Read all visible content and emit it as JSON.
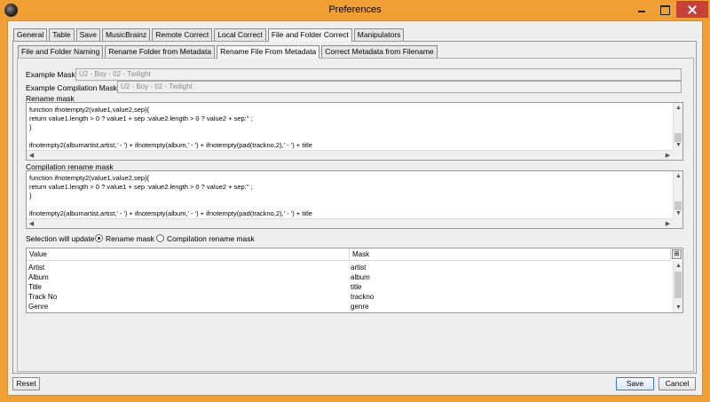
{
  "window": {
    "title": "Preferences"
  },
  "tabs_outer": [
    "General",
    "Table",
    "Save",
    "MusicBrainz",
    "Remote Correct",
    "Local Correct",
    "File and Folder Correct",
    "Manipulators"
  ],
  "tabs_outer_active": "File and Folder Correct",
  "tabs_inner": [
    "File and Folder Naming",
    "Rename Folder from Metadata",
    "Rename File From Metadata",
    "Correct Metadata from Filename"
  ],
  "tabs_inner_active": "Rename File From Metadata",
  "example_mask": {
    "label": "Example Mask:",
    "value": "U2 - Boy - 02 - Twilight"
  },
  "example_compilation_mask": {
    "label": "Example Compilation Mask:",
    "value": "U2 - Boy - 02 - Twilight"
  },
  "rename_mask": {
    "label": "Rename mask",
    "lines": [
      "function ifnotempty2(value1,value2,sep){",
      "    return value1.length > 0 ? value1 + sep :value2.length > 0 ? value2 + sep:'' ;",
      "}",
      "",
      "ifnotempty2(albumartist,artist,' - ') + ifnotempty(album,' - ') + ifnotempty(pad(trackno,2),' - ') + title"
    ]
  },
  "compilation_rename_mask": {
    "label": "Compilation rename mask",
    "lines": [
      "function ifnotempty2(value1,value2,sep){",
      "    return value1.length > 0 ? value1 + sep :value2.length > 0 ? value2 + sep:'' ;",
      "}",
      "",
      "ifnotempty2(albumartist,artist,' - ') + ifnotempty(album,' - ') + ifnotempty(pad(trackno,2),' - ') + title"
    ]
  },
  "selection": {
    "label": "Selection will update",
    "options": [
      "Rename mask",
      "Compilation rename mask"
    ],
    "selected": "Rename mask"
  },
  "table": {
    "headers": [
      "Value",
      "Mask"
    ],
    "rows": [
      [
        "Artist",
        "artist"
      ],
      [
        "Album",
        "album"
      ],
      [
        "Title",
        "title"
      ],
      [
        "Track No",
        "trackno"
      ],
      [
        "Genre",
        "genre"
      ]
    ]
  },
  "buttons": {
    "reset": "Reset",
    "save": "Save",
    "cancel": "Cancel"
  },
  "icons": {
    "app": "app-icon",
    "minimize": "minimize-icon",
    "maximize": "maximize-icon",
    "close": "close-icon",
    "table_columns": "column-chooser-icon"
  }
}
